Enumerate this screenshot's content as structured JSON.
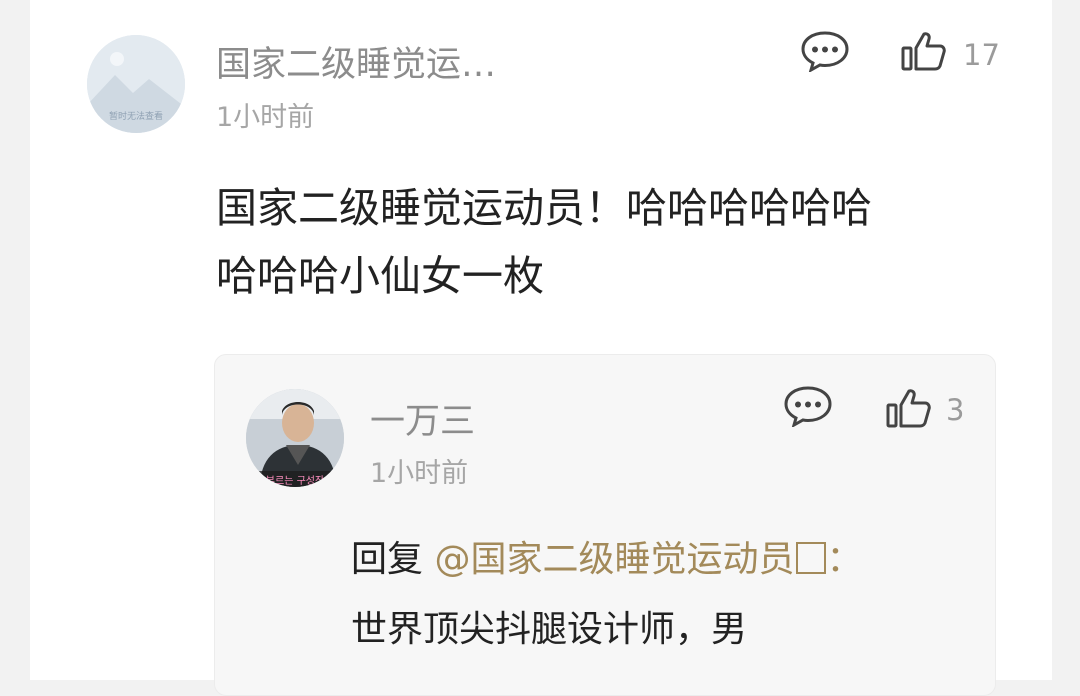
{
  "comment": {
    "avatar_placeholder": "暂时无法查看",
    "username": "国家二级睡觉运…",
    "time": "1小时前",
    "content_line1": "国家二级睡觉运动员！哈哈哈哈哈哈",
    "content_line2": "哈哈哈小仙女一枚",
    "like_count": "17",
    "reply_icon": "comment-bubble-icon",
    "like_icon": "thumbs-up-icon"
  },
  "reply": {
    "avatar_caption": "부르는 구성장",
    "username": "一万三",
    "time": "1小时前",
    "reply_prefix": "回复",
    "mention": "@国家二级睡觉运动员",
    "mention_suffix": "：",
    "text": "世界顶尖抖腿设计师，男",
    "like_count": "3"
  }
}
